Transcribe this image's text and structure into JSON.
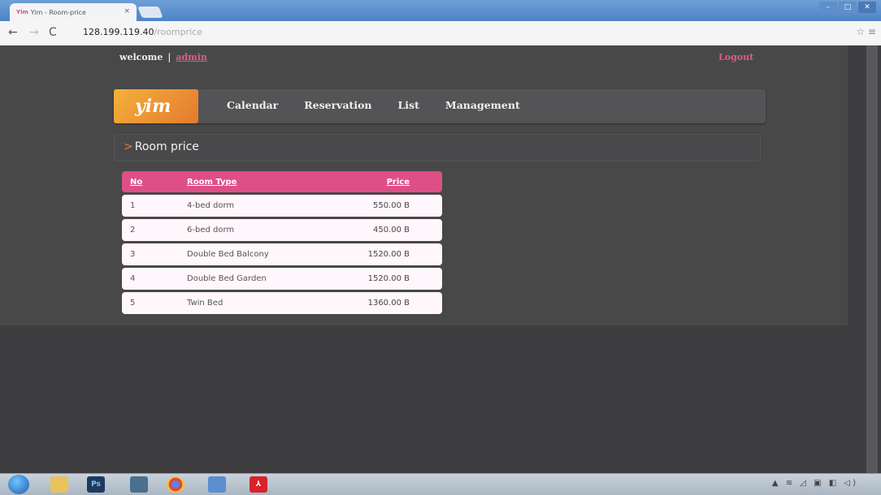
{
  "browser": {
    "tab_title": "Yim - Room-price",
    "tab_favicon": "Yim",
    "url_host": "128.199.119.40",
    "url_path": "/roomprice"
  },
  "header": {
    "welcome": "welcome",
    "separator": "|",
    "username": "admin",
    "logout": "Logout"
  },
  "nav": {
    "logo": "yim",
    "items": [
      "Calendar",
      "Reservation",
      "List",
      "Management"
    ]
  },
  "page": {
    "breadcrumb_arrow": ">",
    "title": "Room price"
  },
  "table": {
    "columns": [
      "No",
      "Room Type",
      "Price"
    ],
    "rows": [
      {
        "no": "1",
        "type": "4-bed dorm",
        "price": "550.00 B"
      },
      {
        "no": "2",
        "type": "6-bed dorm",
        "price": "450.00 B"
      },
      {
        "no": "3",
        "type": "Double Bed Balcony",
        "price": "1520.00 B"
      },
      {
        "no": "4",
        "type": "Double Bed Garden",
        "price": "1520.00 B"
      },
      {
        "no": "5",
        "type": "Twin Bed",
        "price": "1360.00 B"
      }
    ]
  },
  "taskbar": {
    "icons": [
      "windows-start-icon",
      "file-explorer-icon",
      "photoshop-icon",
      "media-icon",
      "chrome-icon",
      "paint-icon",
      "acrobat-icon"
    ]
  },
  "colors": {
    "accent": "#de4f86",
    "logo": "#f4b13a",
    "page_bg": "#3e3e40"
  }
}
